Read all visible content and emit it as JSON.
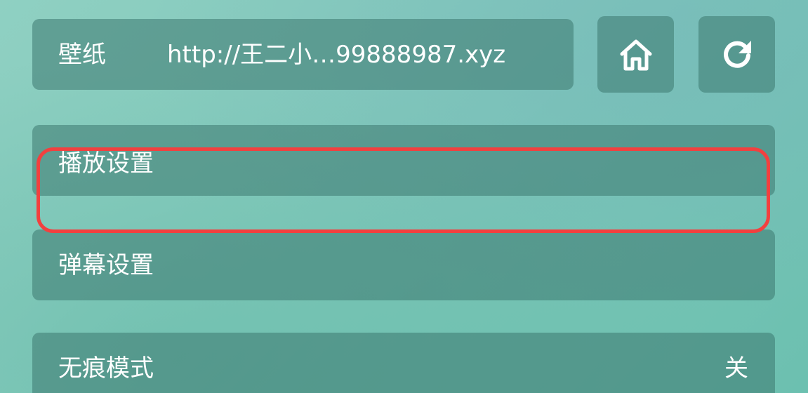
{
  "wallpaper": {
    "label": "壁纸",
    "url": "http://王二小…99888987.xyz"
  },
  "buttons": {
    "home_icon": "home-icon",
    "refresh_icon": "refresh-icon"
  },
  "menu": {
    "playback_settings": "播放设置",
    "danmaku_settings": "弹幕设置",
    "incognito_mode": "无痕模式",
    "incognito_value": "关"
  },
  "colors": {
    "highlight": "#f2403f",
    "card": "rgba(60,120,112,0.55)"
  }
}
